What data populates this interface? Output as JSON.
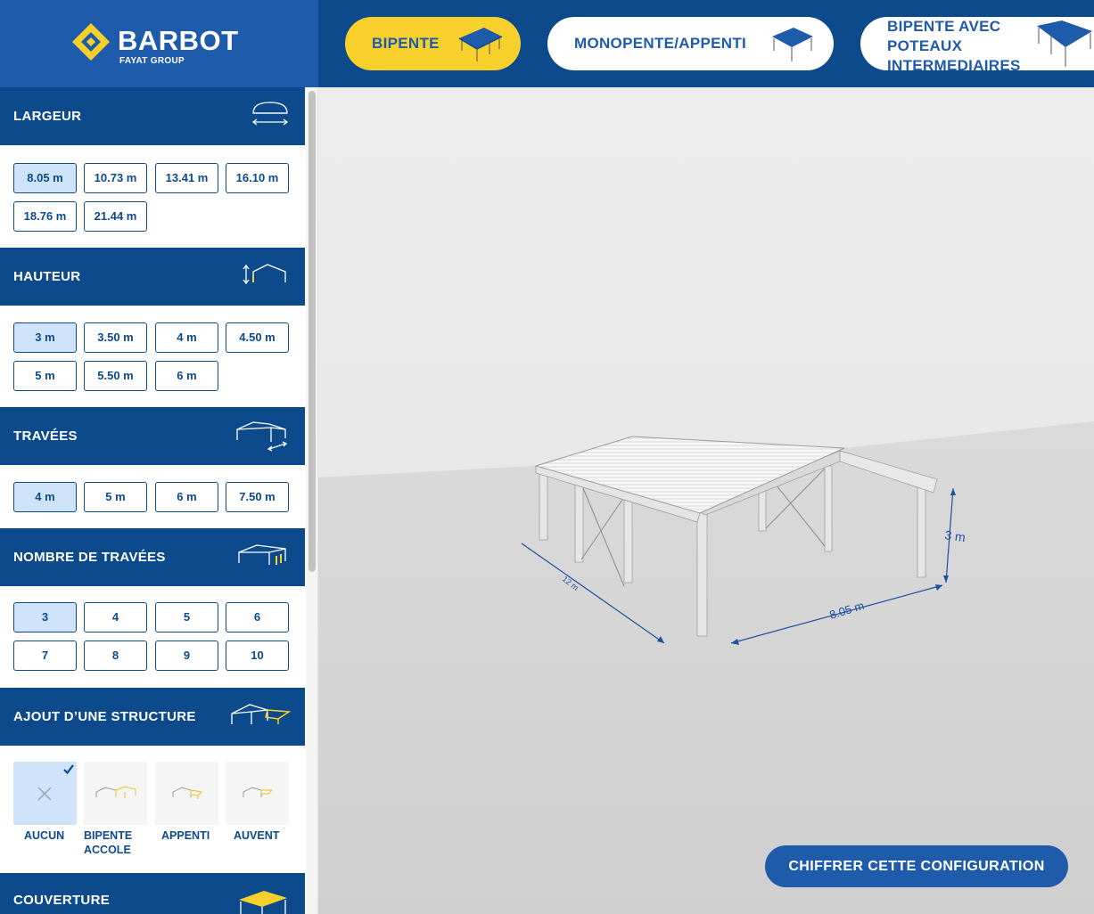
{
  "brand": {
    "name": "BARBOT",
    "group": "FAYAT GROUP",
    "colors": {
      "primary": "#0c4a8c",
      "accent": "#f8d02c",
      "button": "#1f5bab"
    }
  },
  "building_types": [
    {
      "label": "BIPENTE",
      "active": true
    },
    {
      "label": "MONOPENTE/APPENTI",
      "active": false
    },
    {
      "label": "BIPENTE AVEC POTEAUX INTERMEDIAIRES",
      "active": false
    }
  ],
  "sections": {
    "largeur": {
      "title": "LARGEUR",
      "options": [
        "8.05 m",
        "10.73 m",
        "13.41 m",
        "16.10 m",
        "18.76 m",
        "21.44 m"
      ],
      "selected": "8.05 m"
    },
    "hauteur": {
      "title": "HAUTEUR",
      "options": [
        "3 m",
        "3.50 m",
        "4 m",
        "4.50 m",
        "5 m",
        "5.50 m",
        "6 m"
      ],
      "selected": "3 m"
    },
    "travees": {
      "title": "TRAVÉES",
      "options": [
        "4 m",
        "5 m",
        "6 m",
        "7.50 m"
      ],
      "selected": "4 m"
    },
    "nombre": {
      "title": "NOMBRE DE TRAVÉES",
      "options": [
        "3",
        "4",
        "5",
        "6",
        "7",
        "8",
        "9",
        "10"
      ],
      "selected": "3"
    },
    "structure": {
      "title": "AJOUT D’UNE STRUCTURE",
      "options": [
        "AUCUN",
        "BIPENTE ACCOLE",
        "APPENTI",
        "AUVENT"
      ],
      "selected": "AUCUN"
    },
    "couverture": {
      "title": "COUVERTURE"
    }
  },
  "viewer": {
    "dim_height": "3 m",
    "dim_width": "8.05 m",
    "dim_length": "12 m"
  },
  "cta": {
    "label": "CHIFFRER CETTE CONFIGURATION"
  }
}
